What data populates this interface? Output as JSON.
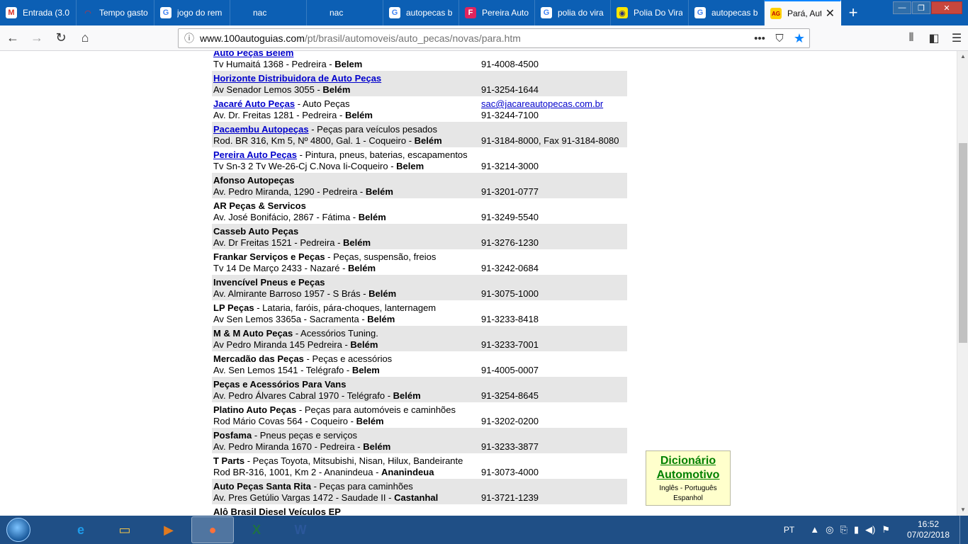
{
  "browser": {
    "tabs": [
      {
        "label": "Entrada (3.0",
        "icon": "gmail-icon",
        "icon_char": "M",
        "icon_color": "#d93025",
        "icon_bg": "#ffffff",
        "width": 108
      },
      {
        "label": "Tempo gasto",
        "icon": "gauge-icon",
        "icon_char": "◠",
        "icon_color": "#d32f2f",
        "icon_bg": "transparent",
        "width": 110
      },
      {
        "label": "jogo do rem",
        "icon": "google-icon",
        "icon_char": "G",
        "icon_color": "#4285f4",
        "icon_bg": "#ffffff",
        "width": 107
      },
      {
        "label": "nac",
        "icon": "blank-page-icon",
        "icon_char": "",
        "icon_color": "#ffffff",
        "icon_bg": "transparent",
        "width": 108
      },
      {
        "label": "nac",
        "icon": "blank-page-icon",
        "icon_char": "",
        "icon_color": "#ffffff",
        "icon_bg": "transparent",
        "width": 108
      },
      {
        "label": "autopecas b",
        "icon": "google-icon",
        "icon_char": "G",
        "icon_color": "#4285f4",
        "icon_bg": "#ffffff",
        "width": 107
      },
      {
        "label": "Pereira Auto",
        "icon": "pereira-f-icon",
        "icon_char": "F",
        "icon_color": "#ffffff",
        "icon_bg": "#e0245e",
        "width": 107
      },
      {
        "label": "polia do vira",
        "icon": "google-icon",
        "icon_char": "G",
        "icon_color": "#4285f4",
        "icon_bg": "#ffffff",
        "width": 107
      },
      {
        "label": "Polia Do Vira",
        "icon": "mercadolivre-icon",
        "icon_char": "◉",
        "icon_color": "#2d3277",
        "icon_bg": "#ffe600",
        "width": 110
      },
      {
        "label": "autopecas b",
        "icon": "google-icon",
        "icon_char": "G",
        "icon_color": "#4285f4",
        "icon_bg": "#ffffff",
        "width": 107
      },
      {
        "label": "Pará, Aut",
        "icon": "100ag-icon",
        "icon_char": "AG",
        "icon_color": "#c00000",
        "icon_bg": "#ffd000",
        "width": 108,
        "active": true
      }
    ],
    "new_tab_glyph": "+",
    "window_controls": {
      "min": "—",
      "max": "❐",
      "close": "✕"
    },
    "nav": {
      "back": "←",
      "forward": "→",
      "reload": "↻",
      "home": "⌂"
    },
    "url": {
      "domain": "www.100autoguias.com",
      "path": "/pt/brasil/automoveis/auto_pecas/novas/para.htm"
    },
    "url_actions": {
      "more": "•••",
      "pocket": "⛉",
      "bookmark": "★"
    },
    "toolbar_right": {
      "library": "⫴",
      "sidebar": "◧",
      "menu": "☰"
    }
  },
  "listings": [
    {
      "name": "Auto Peças Belem",
      "link": true,
      "desc": "",
      "address": "Tv Humaitá 1368 - Pedreira - ",
      "city": "Belem",
      "contact1": "",
      "contact2": "91-4008-4500",
      "shaded": false
    },
    {
      "name": "Horizonte Distribuidora de Auto Peças",
      "link": true,
      "desc": "",
      "address": "Av Senador Lemos 3055 - ",
      "city": "Belém",
      "contact1": "",
      "contact2": "91-3254-1644",
      "shaded": true
    },
    {
      "name": "Jacaré Auto Peças",
      "link": true,
      "desc": " - Auto Peças",
      "address": "Av. Dr. Freitas 1281 - Pedreira - ",
      "city": "Belém",
      "contact1": "sac@jacareautopecas.com.br",
      "contact2": "91-3244-7100",
      "shaded": false
    },
    {
      "name": "Pacaembu Autopeças",
      "link": true,
      "desc": " - Peças para veículos pesados",
      "address": "Rod. BR 316, Km 5, Nº 4800, Gal. 1 - Coqueiro - ",
      "city": "Belém",
      "contact1": "",
      "contact2": "91-3184-8000, Fax 91-3184-8080",
      "shaded": true
    },
    {
      "name": "Pereira Auto Peças",
      "link": true,
      "desc": " - Pintura, pneus, baterias, escapamentos",
      "address": "Tv Sn-3 2 Tv We-26-Cj C.Nova Ii-Coqueiro - ",
      "city": "Belem",
      "contact1": "",
      "contact2": "91-3214-3000",
      "shaded": false
    },
    {
      "name": "Afonso Autopeças",
      "link": false,
      "desc": "",
      "address": "Av. Pedro Miranda, 1290 - Pedreira - ",
      "city": "Belém",
      "contact1": "",
      "contact2": "91-3201-0777",
      "shaded": true
    },
    {
      "name": "AR Peças & Servicos",
      "link": false,
      "desc": "",
      "address": "Av. José Bonifácio, 2867 - Fátima - ",
      "city": "Belém",
      "contact1": "",
      "contact2": "91-3249-5540",
      "shaded": false
    },
    {
      "name": "Casseb Auto Peças",
      "link": false,
      "desc": "",
      "address": "Av. Dr Freitas 1521 - Pedreira - ",
      "city": "Belém",
      "contact1": "",
      "contact2": "91-3276-1230",
      "shaded": true
    },
    {
      "name": "Frankar Serviços e Peças",
      "link": false,
      "desc": " - Peças, suspensão, freios",
      "address": "Tv 14 De Março 2433 - Nazaré - ",
      "city": "Belém",
      "contact1": "",
      "contact2": "91-3242-0684",
      "shaded": false
    },
    {
      "name": "Invencível Pneus e Peças",
      "link": false,
      "desc": "",
      "address": "Av. Almirante Barroso 1957 - S Brás - ",
      "city": "Belém",
      "contact1": "",
      "contact2": "91-3075-1000",
      "shaded": true
    },
    {
      "name": "LP Peças",
      "link": false,
      "desc": " - Lataria, faróis, pára-choques, lanternagem",
      "address": "Av Sen Lemos 3365a - Sacramenta - ",
      "city": "Belém",
      "contact1": "",
      "contact2": "91-3233-8418",
      "shaded": false
    },
    {
      "name": "M & M Auto Peças",
      "link": false,
      "desc": " - Acessórios Tuning.",
      "address": "Av Pedro Miranda 145 Pedreira - ",
      "city": "Belém",
      "contact1": "",
      "contact2": "91-3233-7001",
      "shaded": true
    },
    {
      "name": "Mercadão das Peças",
      "link": false,
      "desc": " - Peças e acessórios",
      "address": "Av. Sen Lemos 1541 - Telégrafo - ",
      "city": "Belem",
      "contact1": "",
      "contact2": "91-4005-0007",
      "shaded": false
    },
    {
      "name": "Peças e Acessórios Para Vans",
      "link": false,
      "desc": "",
      "address": "Av. Pedro Álvares Cabral 1970 - Telégrafo - ",
      "city": "Belém",
      "contact1": "",
      "contact2": "91-3254-8645",
      "shaded": true
    },
    {
      "name": "Platino Auto Peças",
      "link": false,
      "desc": " - Peças para automóveis e caminhões",
      "address": "Rod Mário Covas 564 - Coqueiro - ",
      "city": "Belém",
      "contact1": "",
      "contact2": "91-3202-0200",
      "shaded": false
    },
    {
      "name": "Posfama",
      "link": false,
      "desc": " - Pneus peças e serviços",
      "address": "Av. Pedro Miranda 1670 - Pedreira - ",
      "city": "Belém",
      "contact1": "",
      "contact2": "91-3233-3877",
      "shaded": true
    },
    {
      "name": "T Parts",
      "link": false,
      "desc": " - Peças Toyota, Mitsubishi, Nisan, Hilux, Bandeirante",
      "address": "Rod BR-316, 1001, Km 2 - Ananindeua - ",
      "city": "Ananindeua",
      "contact1": "",
      "contact2": "91-3073-4000",
      "shaded": false
    },
    {
      "name": "Auto Peças Santa Rita",
      "link": false,
      "desc": " - Peças para caminhões",
      "address": "Av. Pres Getúlio Vargas 1472 - Saudade II - ",
      "city": "Castanhal",
      "contact1": "",
      "contact2": "91-3721-1239",
      "shaded": true
    },
    {
      "name": "Alô Brasil Diesel Veículos EP",
      "link": false,
      "desc": "",
      "address": "",
      "city": "",
      "contact1": "",
      "contact2": "",
      "shaded": false
    }
  ],
  "dictionary_box": {
    "title1": "Dicionário",
    "title2": "Automotivo",
    "sub1": "Inglês - Português",
    "sub2": "Espanhol"
  },
  "scrollbar": {
    "up": "▲",
    "down": "▼",
    "grip": "≡"
  },
  "taskbar": {
    "apps": [
      {
        "name": "ie-icon",
        "glyph": "e",
        "color": "#1e9bea",
        "active": false
      },
      {
        "name": "explorer-icon",
        "glyph": "▭",
        "color": "#f3c44a",
        "active": false
      },
      {
        "name": "media-player-icon",
        "glyph": "▶",
        "color": "#e07a1f",
        "active": false
      },
      {
        "name": "firefox-icon",
        "glyph": "●",
        "color": "#ff7139",
        "active": true
      },
      {
        "name": "excel-icon",
        "glyph": "X",
        "color": "#1e7145",
        "active": false
      },
      {
        "name": "word-icon",
        "glyph": "W",
        "color": "#2b579a",
        "active": false
      }
    ],
    "lang": "PT",
    "tray_icons": {
      "up": "▲",
      "net": "◎",
      "usb": "⎘",
      "flag": "⚑",
      "sound": "◀)",
      "battery": "▮"
    },
    "time": "16:52",
    "date": "07/02/2018"
  }
}
